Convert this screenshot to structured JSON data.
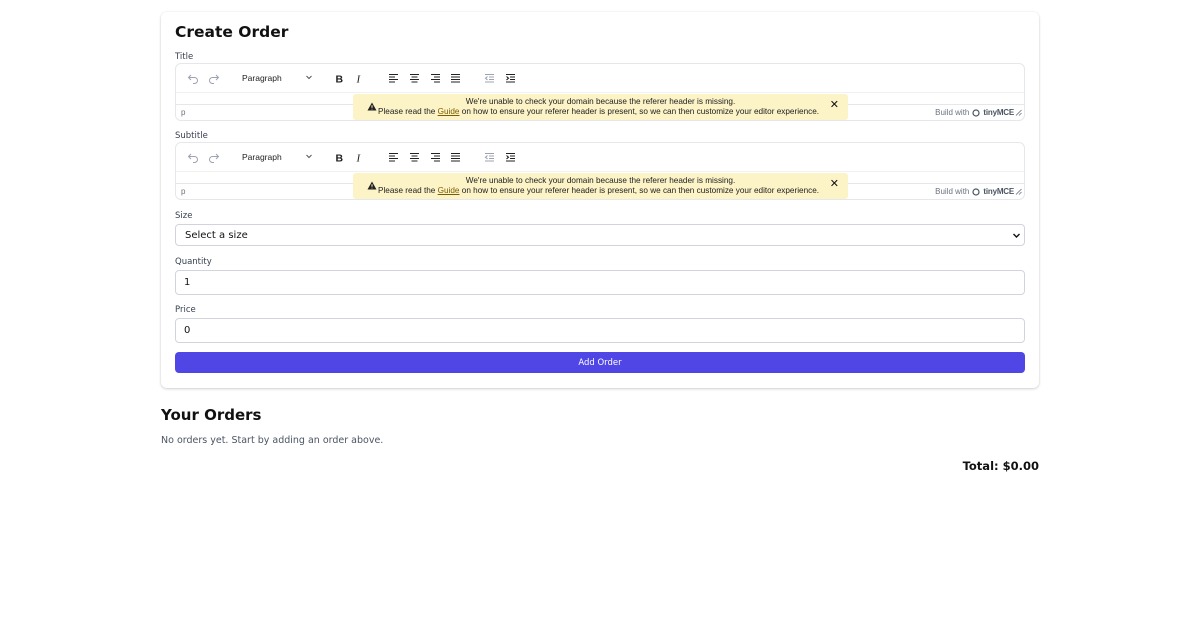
{
  "form": {
    "heading": "Create Order",
    "title_label": "Title",
    "subtitle_label": "Subtitle",
    "size_label": "Size",
    "size_selected": "Select a size",
    "quantity_label": "Quantity",
    "quantity_value": "1",
    "price_label": "Price",
    "price_value": "0",
    "submit_label": "Add Order"
  },
  "editor": {
    "block_format": "Paragraph",
    "path": "p",
    "brand_prefix": "Build with",
    "brand_name": "tinyMCE",
    "notice_line1": "We're unable to check your domain because the referer header is missing.",
    "notice_pre": "Please read the",
    "notice_link": "Guide",
    "notice_post": "on how to ensure your referer header is present, so we can then customize your editor experience.",
    "notice_close": "✕"
  },
  "orders": {
    "heading": "Your Orders",
    "empty_text": "No orders yet. Start by adding an order above.",
    "total_text": "Total: $0.00"
  },
  "colors": {
    "accent": "#4f46e5",
    "notice_bg": "#fcf3c7"
  }
}
